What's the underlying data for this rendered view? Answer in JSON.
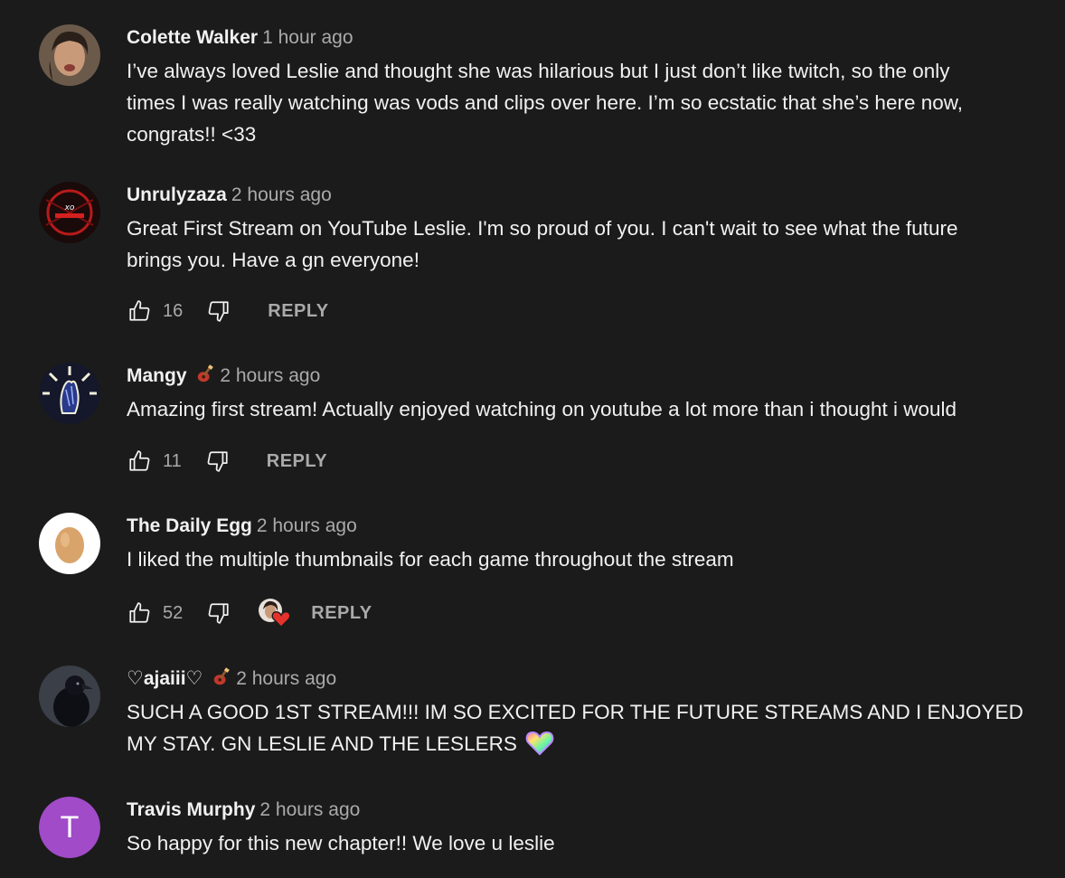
{
  "comments": [
    {
      "author": "Colette Walker",
      "time": "1 hour ago",
      "text_lines": [
        "I’ve always loved Leslie and thought she was hilarious but I just don’t like twitch, so the only",
        "times I was really watching was vods and clips over here. I’m so ecstatic that she’s here now,",
        "congrats!! <33"
      ],
      "avatar": "photo-avatar"
    },
    {
      "author": "Unrulyzaza",
      "time": "2 hours ago",
      "text_lines": [
        "Great First Stream on YouTube Leslie. I'm so proud of you. I can't wait to see what the future",
        "brings you. Have a gn everyone!"
      ],
      "likes": "16",
      "reply_label": "REPLY",
      "avatar": "red-logo-avatar"
    },
    {
      "author": "Mangy",
      "time": "2 hours ago",
      "badge": "guitar-badge-icon",
      "text_lines": [
        "Amazing first stream! Actually enjoyed watching on youtube a lot more than i thought i would"
      ],
      "likes": "11",
      "reply_label": "REPLY",
      "avatar": "hand-art-avatar"
    },
    {
      "author": "The Daily Egg",
      "time": "2 hours ago",
      "text_lines": [
        "I liked the multiple thumbnails for each game throughout the stream"
      ],
      "likes": "52",
      "creator_heart": true,
      "reply_label": "REPLY",
      "avatar": "egg-avatar"
    },
    {
      "author": "♡ajaiii♡",
      "time": "2 hours ago",
      "badge": "guitar-badge-icon",
      "text_lines": [
        "SUCH A GOOD 1ST STREAM!!! IM SO EXCITED FOR THE FUTURE STREAMS AND I ENJOYED",
        "MY STAY. GN LESLIE AND THE LESLERS"
      ],
      "emoji": "rainbow-heart-icon",
      "avatar": "crow-avatar"
    },
    {
      "author": "Travis Murphy",
      "time": "2 hours ago",
      "text_lines": [
        "So happy for this new chapter!! We love u leslie"
      ],
      "avatar_letter": "T",
      "avatar_color": "#a14bc9"
    }
  ],
  "colors": {
    "background": "#1b1b1b",
    "text": "#f1f1f1",
    "secondary": "#aaaaaa",
    "heart_red": "#e5322d"
  }
}
